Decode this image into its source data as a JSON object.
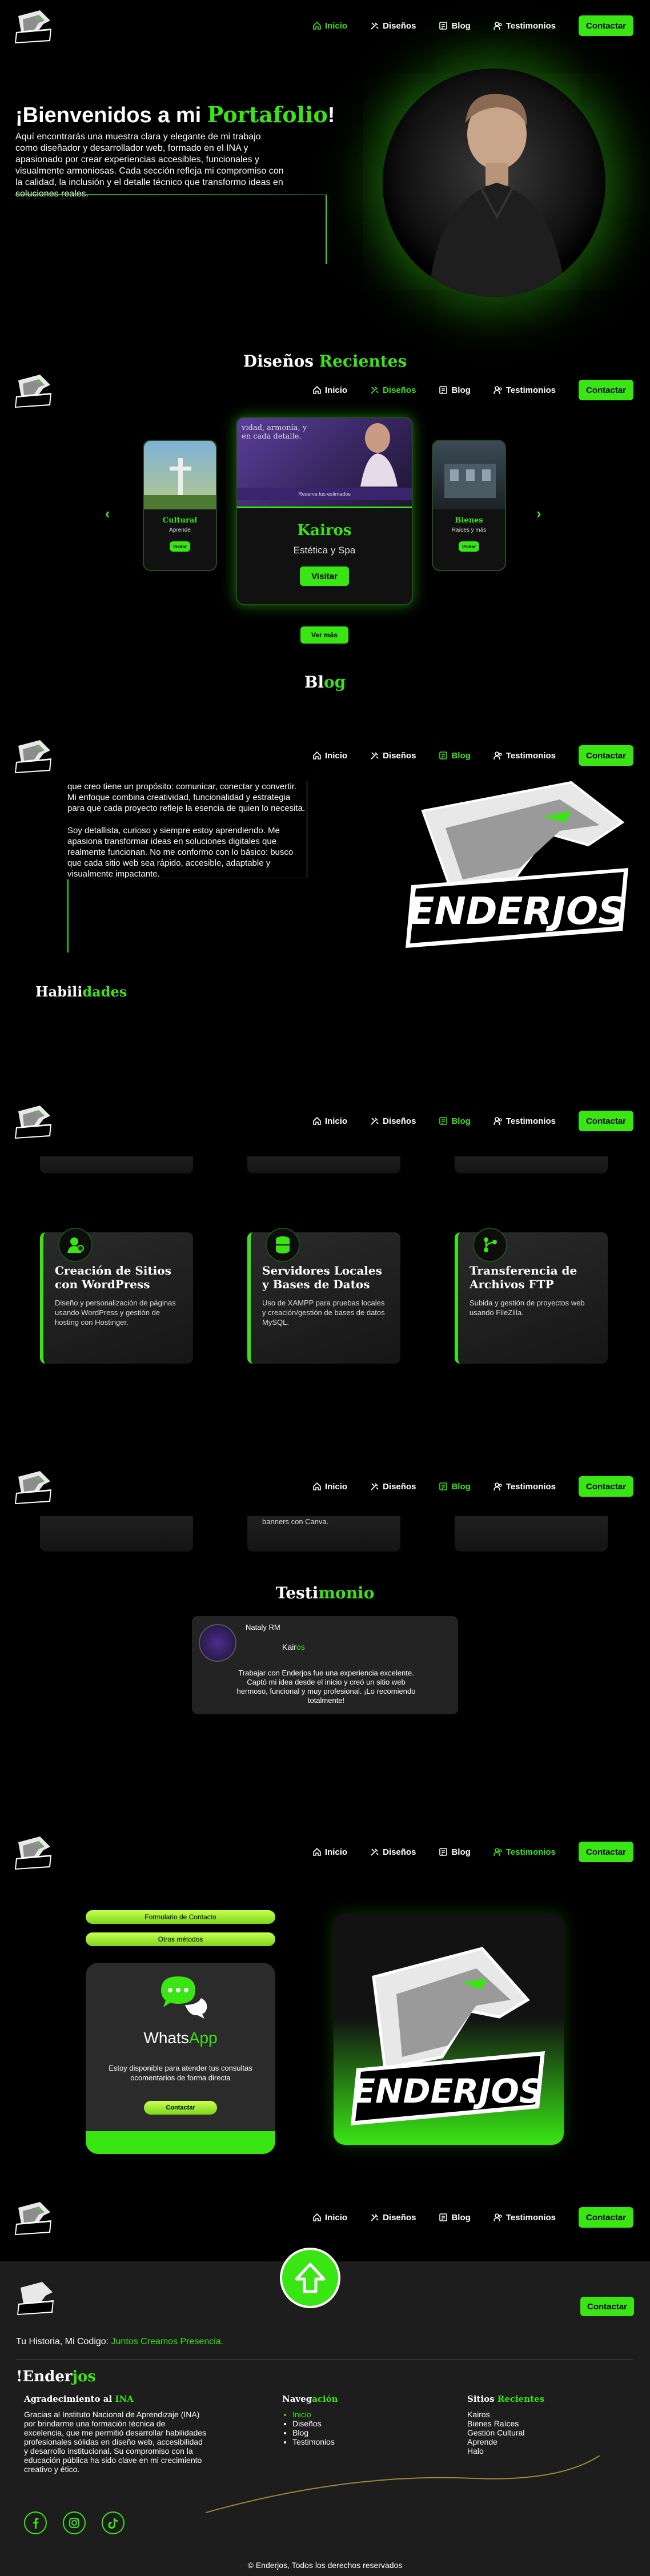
{
  "nav": {
    "items": [
      {
        "label": "Inicio"
      },
      {
        "label": "Diseños"
      },
      {
        "label": "Blog"
      },
      {
        "label": "Testimonios"
      }
    ],
    "contact": "Contactar",
    "logo_text": "ENDERJOS"
  },
  "hero": {
    "title_prefix": "¡Bienvenidos a mi ",
    "title_highlight": "Portafolio",
    "title_suffix": "!",
    "text": "Aquí encontrarás una muestra clara y elegante de mi trabajo como diseñador y desarrollador web, formado en el INA y apasionado por crear experiencias accesibles, funcionales y visualmente armoniosas. Cada sección refleja mi compromiso con la calidad, la inclusión y el detalle técnico que transformo ideas en soluciones reales."
  },
  "designs": {
    "title_a": "Diseños ",
    "title_b": "Recientes",
    "center": {
      "title": "Kairos",
      "subtitle": "Estética y Spa",
      "button": "Visitar",
      "img_caption": "vidad, armonía, y\nen cada detalle.",
      "img_bar": "Reserva tus estimados"
    },
    "left": {
      "title": "Cultural",
      "subtitle": "Aprende",
      "button": "Visitar"
    },
    "right": {
      "title": "Bienes",
      "subtitle": "Raíces y más",
      "button": "Visitar"
    },
    "more": "Ver más",
    "prev_glyph": "‹",
    "next_glyph": "›"
  },
  "blog": {
    "title_a": "Bl",
    "title_b": "og"
  },
  "about": {
    "p1": "que creo tiene un propósito: comunicar, conectar y convertir. Mi enfoque combina creatividad, funcionalidad y estrategia para que cada proyecto refleje la esencia de quien lo necesita.",
    "p2": "Soy detallista, curioso y siempre estoy aprendiendo. Me apasiona transformar ideas en soluciones digitales que realmente funcionan. No me conformo con lo básico: busco que cada sitio web sea rápido, accesible, adaptable y visualmente impactante."
  },
  "skills": {
    "title_a": "Habili",
    "title_b": "dades",
    "cards": [
      {
        "title": "Creación de Sitios con WordPress",
        "text": "Diseño y personalización de páginas usando WordPress y gestión de hosting con Hostinger."
      },
      {
        "title": "Servidores Locales y Bases de Datos",
        "text": "Uso de XAMPP para pruebas locales y creación/gestión de bases de datos MySQL."
      },
      {
        "title": "Transferencia de Archivos FTP",
        "text": "Subida y gestión de proyectos web usando FileZilla."
      }
    ],
    "stub_text": "banners con Canva."
  },
  "testimonials": {
    "title_a": "Testi",
    "title_b": "monio",
    "name": "Nataly RM",
    "company_a": "Kair",
    "company_b": "os",
    "text": "Trabajar con Enderjos fue una experiencia excelente. Captó mi idea desde el inicio y creó un sitio web hermoso, funcional y muy profesional. ¡Lo recomiendo totalmente!"
  },
  "contact": {
    "pill1": "Formulario de Contacto",
    "pill2": "Otros métodos",
    "wa_title_a": "Whats",
    "wa_title_b": "App",
    "wa_text": "Estoy disponible para atender tus consultas ocomentarios de forma directa",
    "wa_button": "Contactar"
  },
  "footer": {
    "contact": "Contactar",
    "tagline_a": "Tu Historia, Mi Codigo: ",
    "tagline_b": "Juntos Creamos Presencia.",
    "brand_a": "!Ender",
    "brand_b": "jos",
    "thanks_title_a": "Agradecimiento al ",
    "thanks_title_b": "INA",
    "thanks_text": "Gracias al Instituto Nacional de Aprendizaje (INA) por brindarme una formación técnica de excelencia, que me permitió desarrollar habilidades profesionales sólidas en diseño web, accesibilidad y desarrollo institucional. Su compromiso con la educación pública ha sido clave en mi crecimiento creativo y ético.",
    "nav_title_a": "Naveg",
    "nav_title_b": "ación",
    "nav_links": [
      "Inicio",
      "Diseños",
      "Blog",
      "Testimonios"
    ],
    "sites_title_a": "Sitios ",
    "sites_title_b": "Recientes",
    "sites": [
      "Kairos",
      "Bienes Raíces",
      "Gestión Cultural",
      "Aprende",
      "Halo"
    ],
    "copyright": "© Enderjos, Todos los derechos reservados"
  },
  "colors": {
    "accent": "#39e614",
    "bg": "#000000",
    "card": "#232323",
    "footer": "#1d1d1d"
  }
}
